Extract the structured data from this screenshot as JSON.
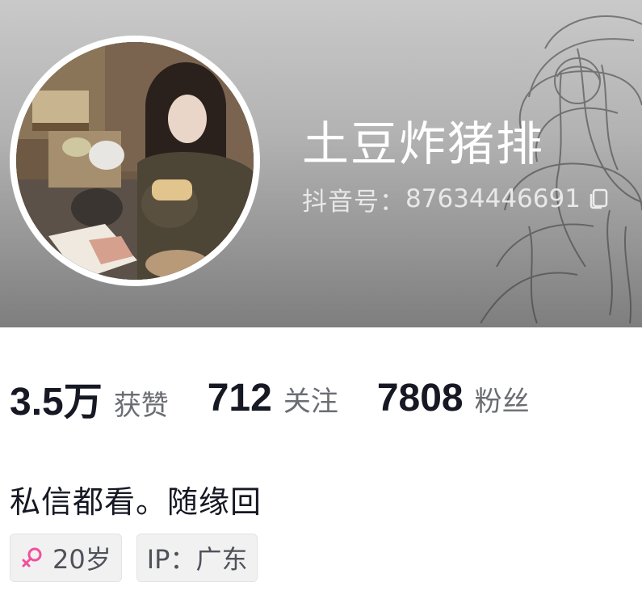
{
  "profile": {
    "nickname": "土豆炸猪排",
    "account_id_label": "抖音号：",
    "account_id": "87634446691",
    "copy_icon": "copy-icon",
    "avatar": "avatar-photo"
  },
  "stats": [
    {
      "value": "3.5万",
      "label": "获赞"
    },
    {
      "value": "712",
      "label": "关注"
    },
    {
      "value": "7808",
      "label": "粉丝"
    }
  ],
  "bio": "私信都看。随缘回",
  "tags": {
    "gender_icon": "female-icon",
    "age": "20岁",
    "ip": "IP：广东"
  },
  "colors": {
    "female_accent": "#f24f9b",
    "text_primary": "#161823",
    "text_secondary": "#6b6d73"
  }
}
